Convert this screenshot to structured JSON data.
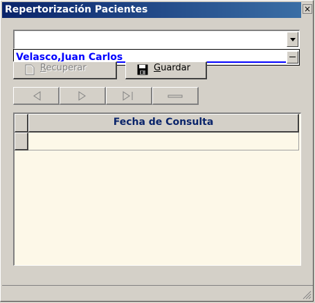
{
  "window": {
    "title": "Repertorización Pacientes",
    "close_glyph": "×"
  },
  "patient_combo": {
    "selected_value": "",
    "options": [
      "Velasco,Juan Carlos"
    ]
  },
  "toolbar": {
    "recuperar_label": "Recuperar",
    "guardar_label": "Guardar",
    "recuperar_icon": "document-icon",
    "guardar_icon": "floppy-disk-icon"
  },
  "navigation": {
    "buttons": [
      {
        "name": "nav-previous-button",
        "icon": "triangle-left-icon"
      },
      {
        "name": "nav-next-button",
        "icon": "triangle-right-icon"
      },
      {
        "name": "nav-last-button",
        "icon": "skip-last-icon"
      },
      {
        "name": "nav-remove-button",
        "icon": "minus-icon"
      }
    ]
  },
  "grid": {
    "columns": [
      "Fecha de Consulta"
    ],
    "rows": [
      [
        ""
      ]
    ]
  },
  "colors": {
    "titlebar_start": "#0a246a",
    "titlebar_end": "#3a6ea5",
    "selected_text": "#0000ff",
    "grid_background": "#fdf8e8",
    "header_text": "#0a246a"
  }
}
